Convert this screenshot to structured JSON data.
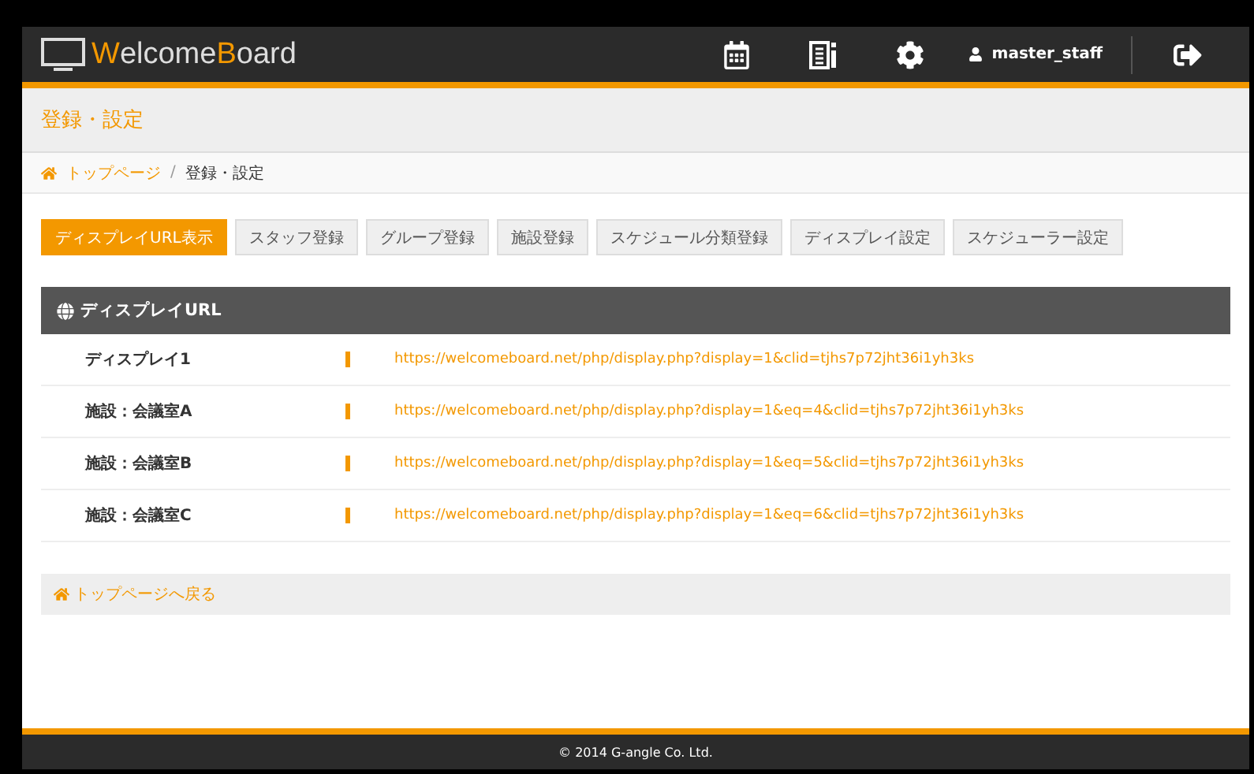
{
  "header": {
    "logo": [
      {
        "text": "W",
        "accent": true
      },
      {
        "text": "elcome",
        "accent": false
      },
      {
        "text": "B",
        "accent": true
      },
      {
        "text": "oard",
        "accent": false
      }
    ],
    "user": "master_staff"
  },
  "page_title": "登録・設定",
  "breadcrumb_separator": "/",
  "breadcrumb": [
    {
      "label": "トップページ",
      "link": true
    },
    {
      "label": "登録・設定",
      "link": false
    }
  ],
  "tabs": [
    {
      "label": "ディスプレイURL表示",
      "selected": true
    },
    {
      "label": "スタッフ登録",
      "selected": false
    },
    {
      "label": "グループ登録",
      "selected": false
    },
    {
      "label": "施設登録",
      "selected": false
    },
    {
      "label": "スケジュール分類登録",
      "selected": false
    },
    {
      "label": "ディスプレイ設定",
      "selected": false
    },
    {
      "label": "スケジューラー設定",
      "selected": false
    }
  ],
  "panel": {
    "title": "ディスプレイURL",
    "rows": [
      {
        "name": "ディスプレイ1",
        "url": "https://welcomeboard.net/php/display.php?display=1&clid=tjhs7p72jht36i1yh3ks"
      },
      {
        "name": "施設：会議室A",
        "url": "https://welcomeboard.net/php/display.php?display=1&eq=4&clid=tjhs7p72jht36i1yh3ks"
      },
      {
        "name": "施設：会議室B",
        "url": "https://welcomeboard.net/php/display.php?display=1&eq=5&clid=tjhs7p72jht36i1yh3ks"
      },
      {
        "name": "施設：会議室C",
        "url": "https://welcomeboard.net/php/display.php?display=1&eq=6&clid=tjhs7p72jht36i1yh3ks"
      }
    ]
  },
  "back_link": "トップページへ戻る",
  "footer": "© 2014 G-angle Co. Ltd."
}
